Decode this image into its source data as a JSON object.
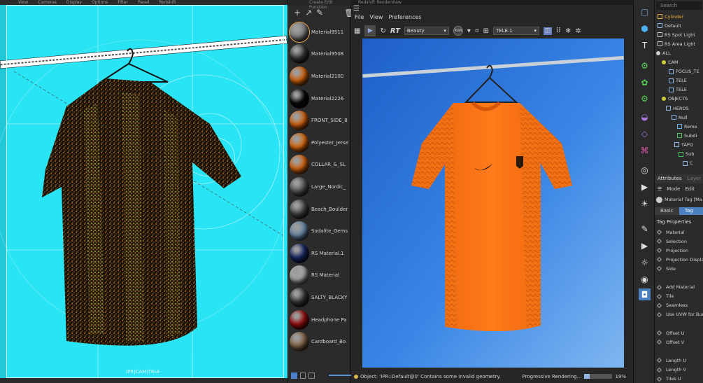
{
  "viewport": {
    "menu": [
      "View",
      "Cameras",
      "Display",
      "Options",
      "Filter",
      "Panel",
      "Redshift"
    ],
    "status_text": "IPR|CAM|TELE"
  },
  "materials": {
    "panel_menu": "Create   Edit   Function",
    "items": [
      {
        "label": "Material9511",
        "swatch": "#8a8a8a",
        "selected": true
      },
      {
        "label": "Material9508",
        "swatch": "#3a3a3a"
      },
      {
        "label": "Material2100",
        "swatch": "#e06a10"
      },
      {
        "label": "Material2226",
        "swatch": "#0a0a0a"
      },
      {
        "label": "FRONT_SIDE_8",
        "swatch": "#e06a10"
      },
      {
        "label": "Polyester_Jerse",
        "swatch": "#e8720f"
      },
      {
        "label": "COLLAR_&_SL",
        "swatch": "#e06a10"
      },
      {
        "label": "Large_Nordic_",
        "swatch": "#5a5a5a"
      },
      {
        "label": "Beach_Boulder",
        "swatch": "#4c4c4c"
      },
      {
        "label": "Sodalite_Gems",
        "swatch": "#6f8fb0"
      },
      {
        "label": "RS Material.1",
        "swatch": "#1a2a6a"
      },
      {
        "label": "RS Material",
        "swatch": "#b0b0b0"
      },
      {
        "label": "SALTY_BLACKY",
        "swatch": "#3a3a3a"
      },
      {
        "label": "Headphone Pa",
        "swatch": "#a01010"
      },
      {
        "label": "Cardboard_Bo",
        "swatch": "#8a6a4a"
      }
    ]
  },
  "render": {
    "title": "Redshift RenderView",
    "menu": [
      "File",
      "View",
      "Preferences"
    ],
    "aov": "Beauty",
    "camera": "TELE.1",
    "status": "Object: 'IPR::Default@0' Contains some invalid geometry.",
    "progress_label": "Progressive Rendering...",
    "progress_pct": "19%",
    "progress_value": 0.19
  },
  "objects": {
    "search_placeholder": "Search",
    "rows": [
      {
        "label": "Cylinder",
        "indent": 4,
        "color": "#e0a93a",
        "kind": "item",
        "active": true
      },
      {
        "label": "Default",
        "indent": 4,
        "color": "#8fb6e6",
        "kind": "item"
      },
      {
        "label": "RS Spot Light",
        "indent": 4,
        "color": "#cfcfcf",
        "kind": "item"
      },
      {
        "label": "RS Area Light",
        "indent": 4,
        "color": "#cfcfcf",
        "kind": "item"
      },
      {
        "label": "ALL",
        "indent": 2,
        "color": "#cfcfcf",
        "kind": "dot"
      },
      {
        "label": "CAM",
        "indent": 10,
        "color": "#c9c93a",
        "kind": "dot"
      },
      {
        "label": "FOCUS_TE",
        "indent": 20,
        "color": "#8fb6e6",
        "kind": "item"
      },
      {
        "label": "TELE",
        "indent": 20,
        "color": "#8fb6e6",
        "kind": "item"
      },
      {
        "label": "TELE",
        "indent": 20,
        "color": "#8fb6e6",
        "kind": "item"
      },
      {
        "label": "OBJECTS",
        "indent": 10,
        "color": "#c9c93a",
        "kind": "dot"
      },
      {
        "label": "HEROS",
        "indent": 16,
        "color": "#8fb6e6",
        "kind": "item"
      },
      {
        "label": "Null",
        "indent": 24,
        "color": "#8fb6e6",
        "kind": "item"
      },
      {
        "label": "Reme",
        "indent": 32,
        "color": "#6fb0e6",
        "kind": "item"
      },
      {
        "label": "Subdi",
        "indent": 32,
        "color": "#4ac05a",
        "kind": "item"
      },
      {
        "label": "TAPO",
        "indent": 28,
        "color": "#8fb6e6",
        "kind": "item"
      },
      {
        "label": "Sub",
        "indent": 34,
        "color": "#4ac05a",
        "kind": "item"
      },
      {
        "label": "C",
        "indent": 40,
        "color": "#8fb6e6",
        "kind": "item"
      }
    ]
  },
  "attributes": {
    "tabs": [
      "Attributes",
      "Layer"
    ],
    "mode": "Mode",
    "edit": "Edit",
    "object_label": "Material Tag [Ma",
    "subtabs": [
      "Basic",
      "Tag"
    ],
    "section_title": "Tag Properties",
    "props": [
      "Material",
      "Selection",
      "Projection",
      "Projection Displa",
      "Side",
      "",
      "Add Material",
      "Tile",
      "Seamless",
      "Use UVW for Bum",
      "",
      "Offset U",
      "Offset V",
      "",
      "Length U",
      "Length V",
      "Tiles U",
      "Tiles V"
    ]
  }
}
